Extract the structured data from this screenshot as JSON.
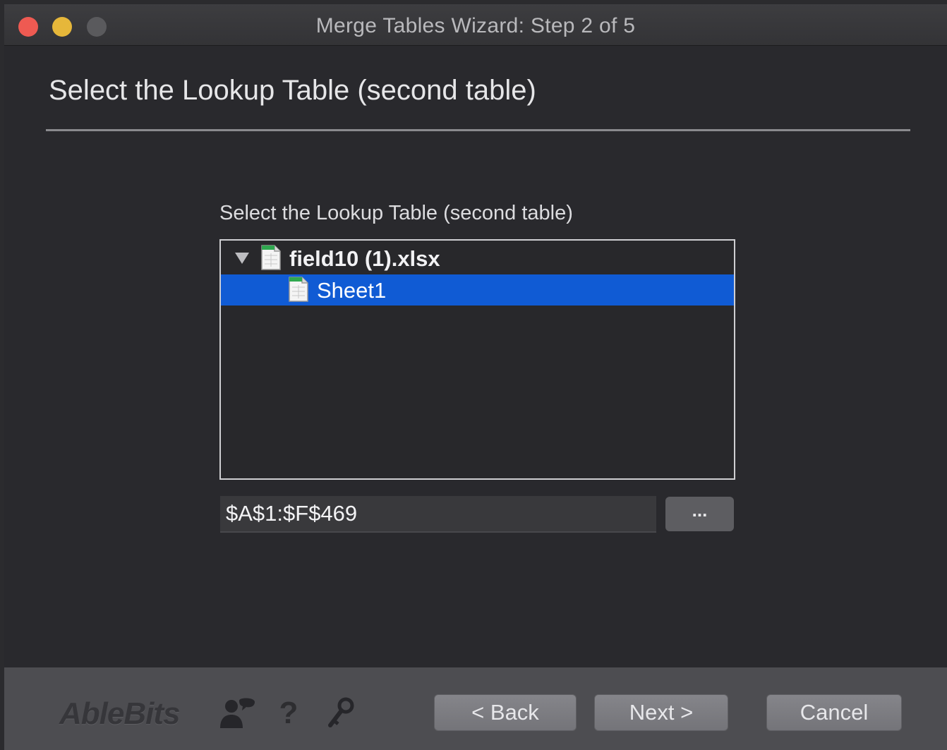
{
  "window": {
    "title": "Merge Tables Wizard: Step 2 of 5"
  },
  "header": {
    "title": "Select the Lookup Table (second table)"
  },
  "main": {
    "section_label": "Select the Lookup Table (second table)",
    "tree": {
      "file": {
        "label": "field10 (1).xlsx",
        "expanded": true,
        "icon": "spreadsheet-file-icon"
      },
      "sheets": [
        {
          "label": "Sheet1",
          "selected": true,
          "icon": "sheet-icon"
        }
      ]
    },
    "range": {
      "value": "$A$1:$F$469"
    },
    "browse_label": "..."
  },
  "footer": {
    "logo": "AbleBits",
    "icons": [
      "users-icon",
      "help-icon",
      "key-icon"
    ],
    "help_glyph": "?",
    "back_label": "< Back",
    "next_label": "Next >",
    "cancel_label": "Cancel"
  },
  "colors": {
    "selection": "#105bd4",
    "close": "#ee5a52",
    "minimize": "#e6b73a",
    "background": "#29292d",
    "footer": "#4d4d51"
  }
}
